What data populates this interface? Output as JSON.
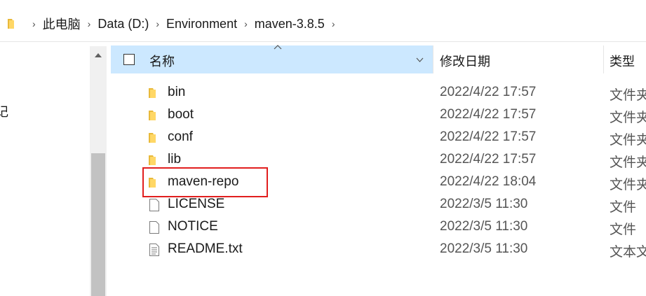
{
  "address_bar": {
    "breadcrumbs": [
      "此电脑",
      "Data (D:)",
      "Environment",
      "maven-3.8.5"
    ],
    "trailing_chevron": "›"
  },
  "nav_pane": {
    "visible_fragment": "记"
  },
  "columns": {
    "name": "名称",
    "date_modified": "修改日期",
    "type": "类型"
  },
  "files": [
    {
      "name": "bin",
      "date": "2022/4/22 17:57",
      "type": "文件夹",
      "icon": "folder-icon"
    },
    {
      "name": "boot",
      "date": "2022/4/22 17:57",
      "type": "文件夹",
      "icon": "folder-icon"
    },
    {
      "name": "conf",
      "date": "2022/4/22 17:57",
      "type": "文件夹",
      "icon": "folder-icon"
    },
    {
      "name": "lib",
      "date": "2022/4/22 17:57",
      "type": "文件夹",
      "icon": "folder-icon"
    },
    {
      "name": "maven-repo",
      "date": "2022/4/22 18:04",
      "type": "文件夹",
      "icon": "folder-icon"
    },
    {
      "name": "LICENSE",
      "date": "2022/3/5 11:30",
      "type": "文件",
      "icon": "file-icon"
    },
    {
      "name": "NOTICE",
      "date": "2022/3/5 11:30",
      "type": "文件",
      "icon": "file-icon"
    },
    {
      "name": "README.txt",
      "date": "2022/3/5 11:30",
      "type": "文本文档",
      "icon": "text-file-icon"
    }
  ],
  "colors": {
    "header_selected": "#cce8ff",
    "folder": "#ffd766",
    "highlight_box": "#e11e1e"
  }
}
